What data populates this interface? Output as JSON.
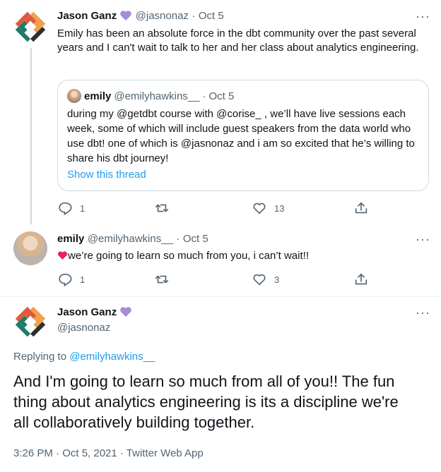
{
  "tweet1": {
    "name": "Jason Ganz",
    "handle": "@jasnonaz",
    "date": "Oct 5",
    "text": "Emily has been an absolute force in the dbt community over the past several years and I can't wait to talk to her and her class about analytics engineering.",
    "quote": {
      "name": "emily",
      "handle": "@emilyhawkins__",
      "date": "Oct 5",
      "text": "during my @getdbt course with @corise_ , we’ll have live sessions each week, some of which will include guest speakers from the data world who use dbt! one of which is @jasnonaz and i am so excited that he’s willing to share his dbt journey!",
      "show_thread": "Show this thread"
    },
    "replies": "1",
    "retweets": "",
    "likes": "13"
  },
  "tweet2": {
    "name": "emily",
    "handle": "@emilyhawkins__",
    "date": "Oct 5",
    "text": "we’re going to learn so much from you, i can’t wait!!",
    "replies": "1",
    "retweets": "",
    "likes": "3"
  },
  "tweet3": {
    "name": "Jason Ganz",
    "handle": "@jasnonaz",
    "replying_prefix": "Replying to",
    "replying_to": "@emilyhawkins__",
    "text": "And I'm going to learn so much from all of you!! The fun thing about analytics engineering is its a discipline we're all collaboratively building together.",
    "meta": "3:26 PM · Oct 5, 2021 · Twitter Web App"
  },
  "colors": {
    "accent": "#1d9bf0",
    "verified_heart": "#a78bdb",
    "text": "#0f1419",
    "muted": "#536471"
  }
}
